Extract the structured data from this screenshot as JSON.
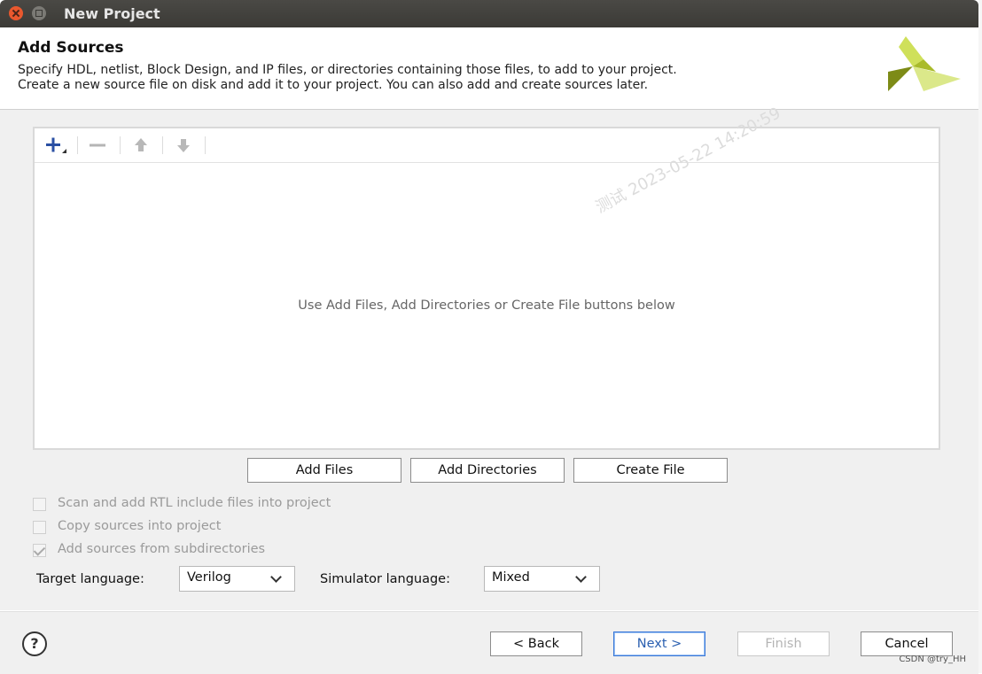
{
  "window": {
    "title": "New Project"
  },
  "header": {
    "title": "Add Sources",
    "desc_line1": "Specify HDL, netlist, Block Design, and IP files, or directories containing those files, to add to your project.",
    "desc_line2": "Create a new source file on disk and add it to your project. You can also add and create sources later."
  },
  "sources": {
    "hint": "Use Add Files, Add Directories or Create File buttons below",
    "watermark": "测试 2023-05-22 14:20:59"
  },
  "buttons": {
    "add_files": "Add Files",
    "add_directories": "Add Directories",
    "create_file": "Create File"
  },
  "options": [
    {
      "label": "Scan and add RTL include files into project",
      "checked": false
    },
    {
      "label": "Copy sources into project",
      "checked": false
    },
    {
      "label": "Add sources from subdirectories",
      "checked": true
    }
  ],
  "language": {
    "target_label": "Target language:",
    "target_value": "Verilog",
    "simulator_label": "Simulator language:",
    "simulator_value": "Mixed"
  },
  "footer": {
    "help": "?",
    "back": "< Back",
    "next": "Next >",
    "finish": "Finish",
    "cancel": "Cancel",
    "credit": "CSDN @try_HH"
  },
  "colors": {
    "accent": "#3a78d8",
    "logo_dark": "#7d8b16",
    "logo_light": "#cfe05a"
  }
}
